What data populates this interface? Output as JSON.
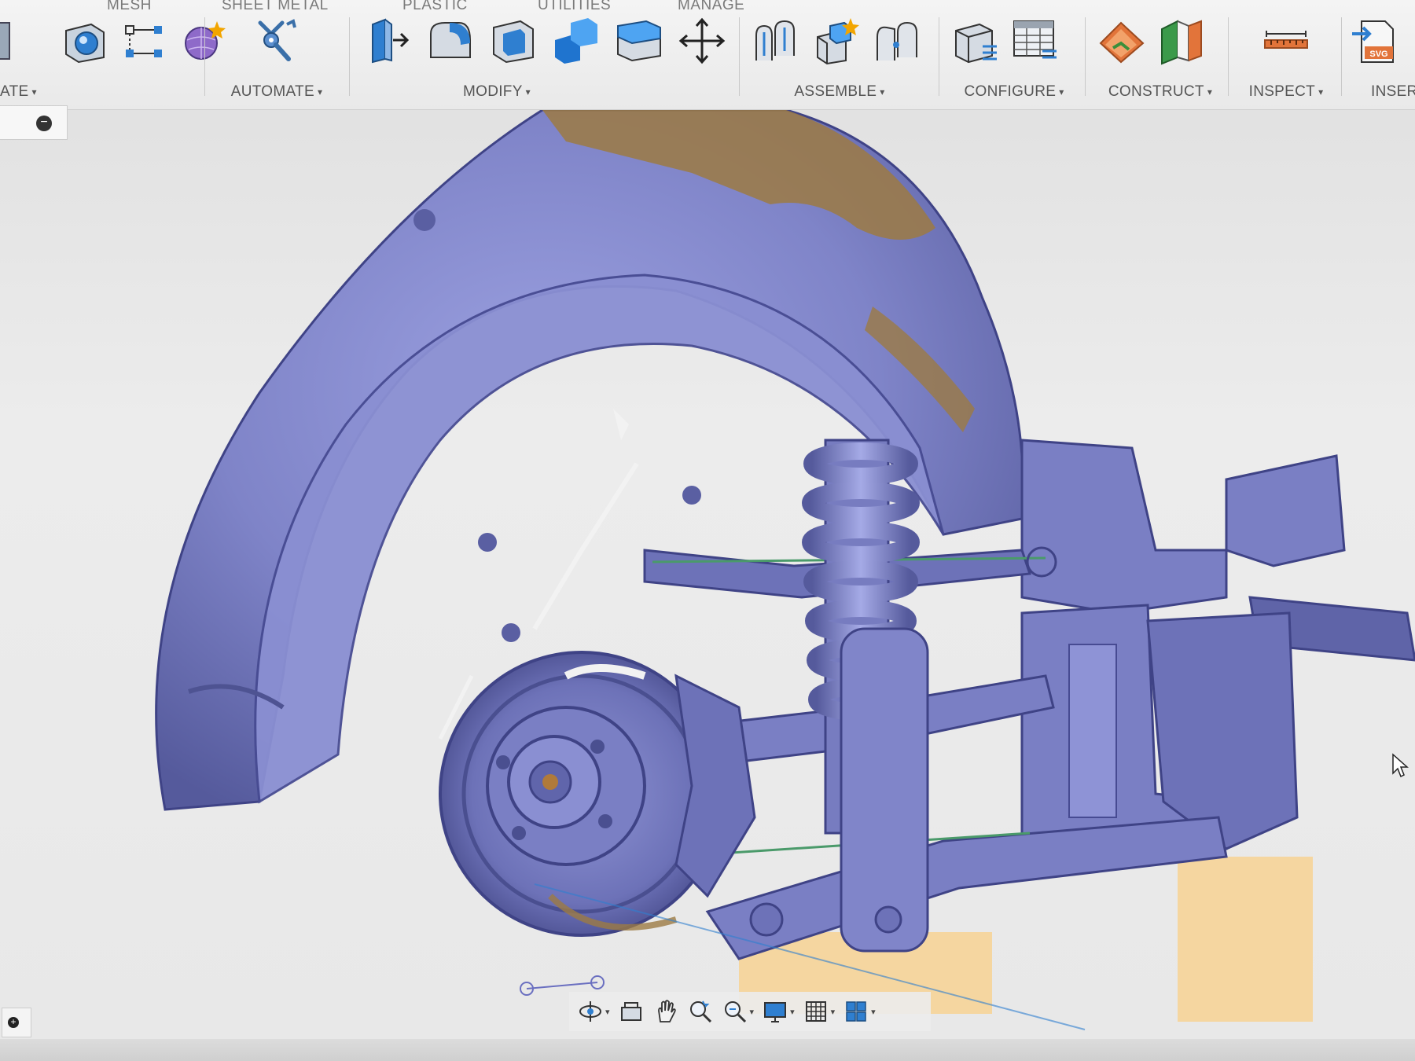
{
  "toolbar": {
    "tabs": [
      {
        "label": "MESH"
      },
      {
        "label": "SHEET METAL"
      },
      {
        "label": "PLASTIC"
      },
      {
        "label": "UTILITIES"
      },
      {
        "label": "MANAGE"
      }
    ],
    "groups": {
      "create": {
        "label": "ATE"
      },
      "automate": {
        "label": "AUTOMATE"
      },
      "modify": {
        "label": "MODIFY"
      },
      "assemble": {
        "label": "ASSEMBLE"
      },
      "configure": {
        "label": "CONFIGURE"
      },
      "construct": {
        "label": "CONSTRUCT"
      },
      "inspect": {
        "label": "INSPECT"
      },
      "insert": {
        "label": "INSER",
        "svg_badge": "SVG"
      }
    },
    "caret": "▾"
  },
  "browser": {
    "collapse_symbol": "−"
  },
  "viewport": {
    "mesh_color": "#7f84c8",
    "mesh_shadow": "#4e5392",
    "texture_color": "#9c7a43",
    "sketch_profile_color": "#f5d59c"
  },
  "navbar": {
    "items": [
      {
        "name": "orbit"
      },
      {
        "name": "look-at"
      },
      {
        "name": "pan"
      },
      {
        "name": "zoom"
      },
      {
        "name": "fit"
      },
      {
        "name": "display-settings"
      },
      {
        "name": "grid-snaps"
      },
      {
        "name": "viewports"
      }
    ]
  },
  "colors": {
    "accent": "#2f7fd0",
    "toolbar_bg": "#efefef"
  }
}
